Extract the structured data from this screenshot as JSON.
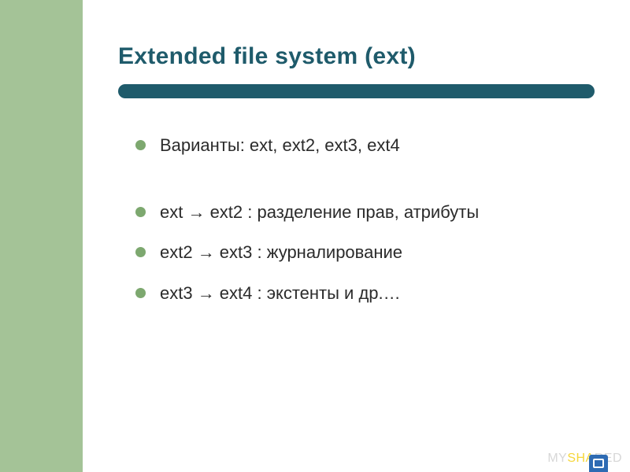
{
  "slide": {
    "title": "Extended file system (ext)",
    "bullets": [
      "Варианты: ext, ext2, ext3, ext4",
      "ext → ext2 : разделение прав, атрибуты",
      "ext2 → ext3 : журналирование",
      "ext3 → ext4 : экстенты и др.…"
    ]
  },
  "watermark": {
    "prefix": "MY",
    "accent": "SHA",
    "suffix": "RED"
  }
}
